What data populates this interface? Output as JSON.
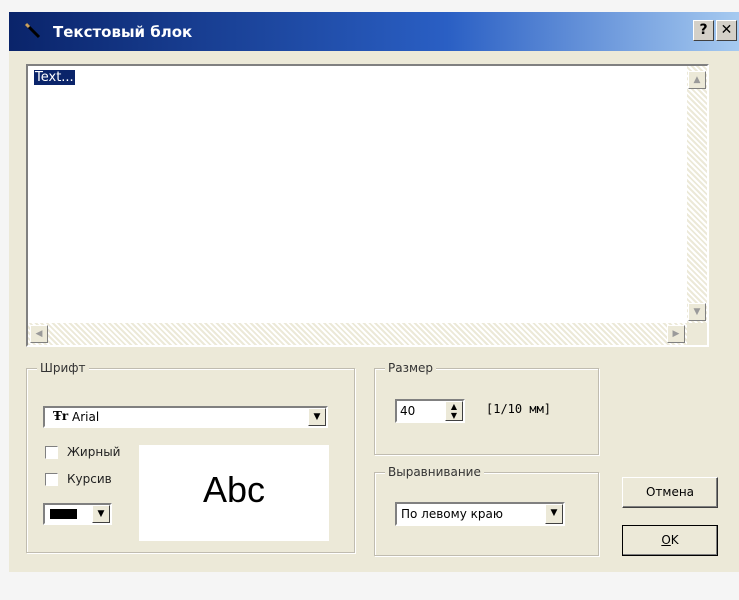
{
  "window": {
    "title": "Текстовый блок",
    "help_label": "?",
    "close_label": "✕"
  },
  "editor": {
    "text": "Text..."
  },
  "font_group": {
    "label": "Шрифт",
    "font_name": "Arial",
    "font_icon": "Ŧr",
    "bold_label": "Жирный",
    "bold_checked": false,
    "italic_label": "Курсив",
    "italic_checked": false,
    "color": "#000000",
    "preview_text": "Abc"
  },
  "size_group": {
    "label": "Размер",
    "value": "40",
    "unit": "[1/10 мм]"
  },
  "align_group": {
    "label": "Выравнивание",
    "value": "По левому краю"
  },
  "buttons": {
    "cancel_label": "Отмена",
    "ok_mnemonic": "O",
    "ok_rest": "K"
  },
  "colors": {
    "title_bar_start": "#0a246a",
    "selection": "#0a246a",
    "dialog_background": "#ece9d8"
  }
}
